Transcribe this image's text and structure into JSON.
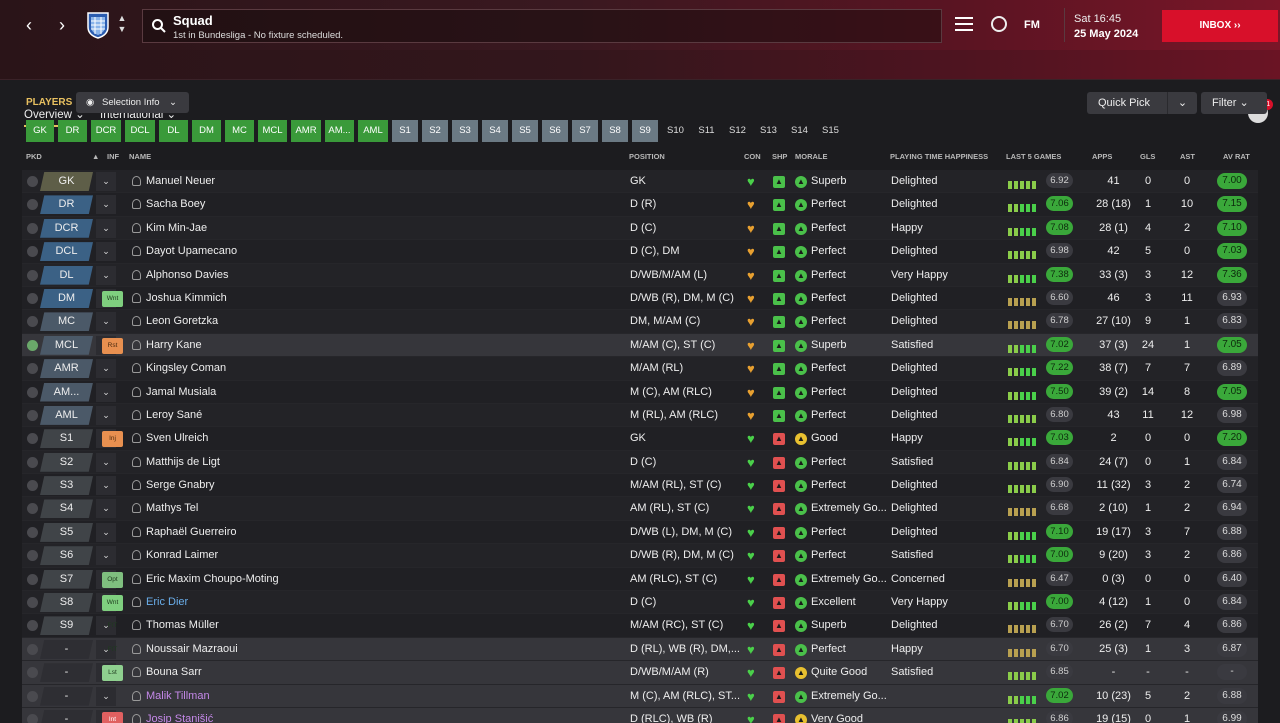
{
  "header": {
    "title": "Squad",
    "subtitle": "1st in Bundesliga - No fixture scheduled.",
    "day_time": "Sat 16:45",
    "date": "25 May 2024",
    "inbox_label": "INBOX",
    "fm_label": "FM",
    "badge_count": "11"
  },
  "tabs": [
    {
      "label": "Overview"
    },
    {
      "label": "International"
    }
  ],
  "toolbar": {
    "players_label": "PLAYERS",
    "selection_info": "Selection Info",
    "quick_pick": "Quick Pick",
    "filter": "Filter"
  },
  "chips": [
    "GK",
    "DR",
    "DCR",
    "DCL",
    "DL",
    "DM",
    "MC",
    "MCL",
    "AMR",
    "AM...",
    "AML",
    "S1",
    "S2",
    "S3",
    "S4",
    "S5",
    "S6",
    "S7",
    "S8",
    "S9",
    "S10",
    "S11",
    "S12",
    "S13",
    "S14",
    "S15"
  ],
  "columns": {
    "pkd": "PKD",
    "inf": "INF",
    "name": "NAME",
    "position": "POSITION",
    "con": "CON",
    "shp": "SHP",
    "morale": "MORALE",
    "pth": "PLAYING TIME HAPPINESS",
    "last5": "LAST 5 GAMES",
    "apps": "APPS",
    "gls": "GLS",
    "ast": "AST",
    "avrat": "AV RAT"
  },
  "colors": {
    "accent": "#e8c060",
    "inbox": "#d8102a",
    "good": "#3aa83a"
  },
  "rows": [
    {
      "pos": "GK",
      "inf": "",
      "name": "Manuel Neuer",
      "position": "GK",
      "morale": "Superb",
      "pth": "Delighted",
      "last5": "6.92",
      "apps": "41",
      "gls": "0",
      "ast": "0",
      "avrat": "7.00"
    },
    {
      "pos": "DR",
      "inf": "",
      "name": "Sacha Boey",
      "position": "D (R)",
      "morale": "Perfect",
      "pth": "Delighted",
      "last5": "7.06",
      "apps": "28 (18)",
      "gls": "1",
      "ast": "10",
      "avrat": "7.15"
    },
    {
      "pos": "DCR",
      "inf": "",
      "name": "Kim Min-Jae",
      "position": "D (C)",
      "morale": "Perfect",
      "pth": "Happy",
      "last5": "7.08",
      "apps": "28 (1)",
      "gls": "4",
      "ast": "2",
      "avrat": "7.10"
    },
    {
      "pos": "DCL",
      "inf": "",
      "name": "Dayot Upamecano",
      "position": "D (C), DM",
      "morale": "Perfect",
      "pth": "Delighted",
      "last5": "6.98",
      "apps": "42",
      "gls": "5",
      "ast": "0",
      "avrat": "7.03"
    },
    {
      "pos": "DL",
      "inf": "",
      "name": "Alphonso Davies",
      "position": "D/WB/M/AM (L)",
      "morale": "Perfect",
      "pth": "Very Happy",
      "last5": "7.38",
      "apps": "33 (3)",
      "gls": "3",
      "ast": "12",
      "avrat": "7.36"
    },
    {
      "pos": "DM",
      "inf": "Wnt",
      "name": "Joshua Kimmich",
      "position": "D/WB (R), DM, M (C)",
      "morale": "Perfect",
      "pth": "Delighted",
      "last5": "6.60",
      "apps": "46",
      "gls": "3",
      "ast": "11",
      "avrat": "6.93"
    },
    {
      "pos": "MC",
      "inf": "",
      "name": "Leon Goretzka",
      "position": "DM, M/AM (C)",
      "morale": "Perfect",
      "pth": "Delighted",
      "last5": "6.78",
      "apps": "27 (10)",
      "gls": "9",
      "ast": "1",
      "avrat": "6.83"
    },
    {
      "pos": "MCL",
      "inf": "Rst",
      "name": "Harry Kane",
      "position": "M/AM (C), ST (C)",
      "morale": "Superb",
      "pth": "Satisfied",
      "last5": "7.02",
      "apps": "37 (3)",
      "gls": "24",
      "ast": "1",
      "avrat": "7.05"
    },
    {
      "pos": "AMR",
      "inf": "",
      "name": "Kingsley Coman",
      "position": "M/AM (RL)",
      "morale": "Perfect",
      "pth": "Delighted",
      "last5": "7.22",
      "apps": "38 (7)",
      "gls": "7",
      "ast": "7",
      "avrat": "6.89"
    },
    {
      "pos": "AM...",
      "inf": "",
      "name": "Jamal Musiala",
      "position": "M (C), AM (RLC)",
      "morale": "Perfect",
      "pth": "Delighted",
      "last5": "7.50",
      "apps": "39 (2)",
      "gls": "14",
      "ast": "8",
      "avrat": "7.05"
    },
    {
      "pos": "AML",
      "inf": "",
      "name": "Leroy Sané",
      "position": "M (RL), AM (RLC)",
      "morale": "Perfect",
      "pth": "Delighted",
      "last5": "6.80",
      "apps": "43",
      "gls": "11",
      "ast": "12",
      "avrat": "6.98"
    },
    {
      "pos": "S1",
      "inf": "Inj",
      "name": "Sven Ulreich",
      "position": "GK",
      "morale": "Good",
      "pth": "Happy",
      "last5": "7.03",
      "apps": "2",
      "gls": "0",
      "ast": "0",
      "avrat": "7.20"
    },
    {
      "pos": "S2",
      "inf": "",
      "name": "Matthijs de Ligt",
      "position": "D (C)",
      "morale": "Perfect",
      "pth": "Satisfied",
      "last5": "6.84",
      "apps": "24 (7)",
      "gls": "0",
      "ast": "1",
      "avrat": "6.84"
    },
    {
      "pos": "S3",
      "inf": "",
      "name": "Serge Gnabry",
      "position": "M/AM (RL), ST (C)",
      "morale": "Perfect",
      "pth": "Delighted",
      "last5": "6.90",
      "apps": "11 (32)",
      "gls": "3",
      "ast": "2",
      "avrat": "6.74"
    },
    {
      "pos": "S4",
      "inf": "",
      "name": "Mathys Tel",
      "position": "AM (RL), ST (C)",
      "morale": "Extremely Go...",
      "pth": "Delighted",
      "last5": "6.68",
      "apps": "2 (10)",
      "gls": "1",
      "ast": "2",
      "avrat": "6.94"
    },
    {
      "pos": "S5",
      "inf": "",
      "name": "Raphaël Guerreiro",
      "position": "D/WB (L), DM, M (C)",
      "morale": "Perfect",
      "pth": "Delighted",
      "last5": "7.10",
      "apps": "19 (17)",
      "gls": "3",
      "ast": "7",
      "avrat": "6.88"
    },
    {
      "pos": "S6",
      "inf": "",
      "name": "Konrad Laimer",
      "position": "D/WB (R), DM, M (C)",
      "morale": "Perfect",
      "pth": "Satisfied",
      "last5": "7.00",
      "apps": "9 (20)",
      "gls": "3",
      "ast": "2",
      "avrat": "6.86"
    },
    {
      "pos": "S7",
      "inf": "Opt",
      "name": "Eric Maxim Choupo-Moting",
      "position": "AM (RLC), ST (C)",
      "morale": "Extremely Go...",
      "pth": "Concerned",
      "last5": "6.47",
      "apps": "0 (3)",
      "gls": "0",
      "ast": "0",
      "avrat": "6.40"
    },
    {
      "pos": "S8",
      "inf": "Wnt",
      "name": "Eric Dier",
      "position": "D (C)",
      "morale": "Excellent",
      "pth": "Very Happy",
      "last5": "7.00",
      "apps": "4 (12)",
      "gls": "1",
      "ast": "0",
      "avrat": "6.84"
    },
    {
      "pos": "S9",
      "inf": "FtT",
      "name": "Thomas Müller",
      "position": "M/AM (RC), ST (C)",
      "morale": "Superb",
      "pth": "Delighted",
      "last5": "6.70",
      "apps": "26 (2)",
      "gls": "7",
      "ast": "4",
      "avrat": "6.86"
    },
    {
      "pos": "-",
      "inf": "FtT",
      "name": "Noussair Mazraoui",
      "position": "D (RL), WB (R), DM,...",
      "morale": "Perfect",
      "pth": "Happy",
      "last5": "6.70",
      "apps": "25 (3)",
      "gls": "1",
      "ast": "3",
      "avrat": "6.87"
    },
    {
      "pos": "-",
      "inf": "Lst",
      "name": "Bouna Sarr",
      "position": "D/WB/M/AM (R)",
      "morale": "Quite Good",
      "pth": "Satisfied",
      "last5": "6.85",
      "apps": "-",
      "gls": "-",
      "ast": "-",
      "avrat": "-"
    },
    {
      "pos": "-",
      "inf": "",
      "name": "Malik Tillman",
      "position": "M (C), AM (RLC), ST...",
      "morale": "Extremely Go...",
      "pth": "",
      "last5": "7.02",
      "apps": "10 (23)",
      "gls": "5",
      "ast": "2",
      "avrat": "6.88"
    },
    {
      "pos": "-",
      "inf": "Int",
      "name": "Josip Stanišić",
      "position": "D (RLC), WB (R)",
      "morale": "Very Good",
      "pth": "",
      "last5": "6.86",
      "apps": "19 (15)",
      "gls": "0",
      "ast": "1",
      "avrat": "6.99"
    }
  ]
}
